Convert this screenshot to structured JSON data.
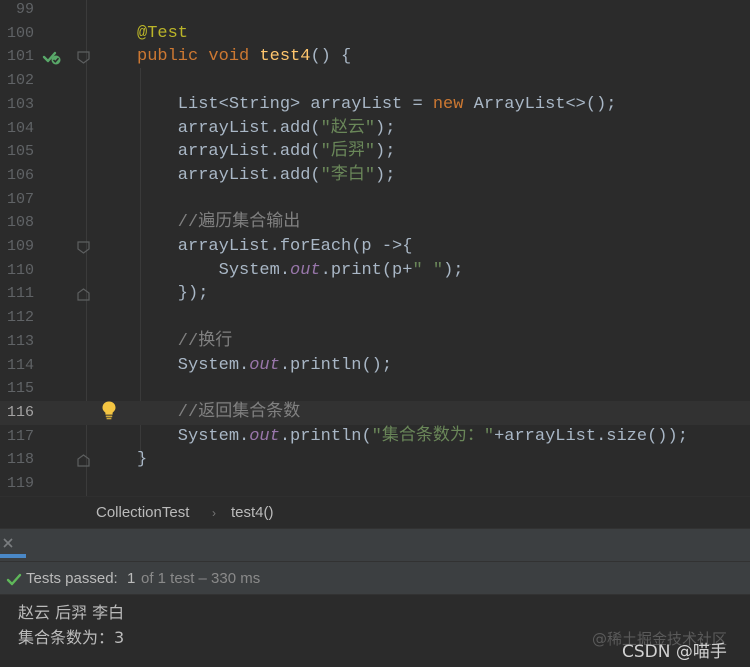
{
  "editor": {
    "current_line": 116,
    "lines": [
      {
        "no": "99",
        "tokens": []
      },
      {
        "no": "100",
        "tokens": [
          {
            "t": "@Test",
            "c": "ann"
          }
        ]
      },
      {
        "no": "101",
        "tokens": [
          {
            "t": "public",
            "c": "kw"
          },
          {
            "t": " ",
            "c": "default"
          },
          {
            "t": "void",
            "c": "kw"
          },
          {
            "t": " ",
            "c": "default"
          },
          {
            "t": "test4",
            "c": "fn"
          },
          {
            "t": "() {",
            "c": "default"
          }
        ]
      },
      {
        "no": "102",
        "tokens": []
      },
      {
        "no": "103",
        "tokens": [
          {
            "t": "    List<String> arrayList = ",
            "c": "default"
          },
          {
            "t": "new",
            "c": "kw"
          },
          {
            "t": " ArrayList<>();",
            "c": "default"
          }
        ]
      },
      {
        "no": "104",
        "tokens": [
          {
            "t": "    arrayList.add(",
            "c": "default"
          },
          {
            "t": "\"赵云\"",
            "c": "str"
          },
          {
            "t": ");",
            "c": "default"
          }
        ]
      },
      {
        "no": "105",
        "tokens": [
          {
            "t": "    arrayList.add(",
            "c": "default"
          },
          {
            "t": "\"后羿\"",
            "c": "str"
          },
          {
            "t": ");",
            "c": "default"
          }
        ]
      },
      {
        "no": "106",
        "tokens": [
          {
            "t": "    arrayList.add(",
            "c": "default"
          },
          {
            "t": "\"李白\"",
            "c": "str"
          },
          {
            "t": ");",
            "c": "default"
          }
        ]
      },
      {
        "no": "107",
        "tokens": []
      },
      {
        "no": "108",
        "tokens": [
          {
            "t": "    //遍历集合输出",
            "c": "cmt"
          }
        ]
      },
      {
        "no": "109",
        "tokens": [
          {
            "t": "    arrayList.forEach(p ->{",
            "c": "default"
          }
        ]
      },
      {
        "no": "110",
        "tokens": [
          {
            "t": "        System.",
            "c": "default"
          },
          {
            "t": "out",
            "c": "fld"
          },
          {
            "t": ".print(p+",
            "c": "default"
          },
          {
            "t": "\" \"",
            "c": "str"
          },
          {
            "t": ");",
            "c": "default"
          }
        ]
      },
      {
        "no": "111",
        "tokens": [
          {
            "t": "    });",
            "c": "default"
          }
        ]
      },
      {
        "no": "112",
        "tokens": []
      },
      {
        "no": "113",
        "tokens": [
          {
            "t": "    //换行",
            "c": "cmt"
          }
        ]
      },
      {
        "no": "114",
        "tokens": [
          {
            "t": "    System.",
            "c": "default"
          },
          {
            "t": "out",
            "c": "fld"
          },
          {
            "t": ".println();",
            "c": "default"
          }
        ]
      },
      {
        "no": "115",
        "tokens": []
      },
      {
        "no": "116",
        "tokens": [
          {
            "t": "    //返回集合条数",
            "c": "cmt"
          }
        ]
      },
      {
        "no": "117",
        "tokens": [
          {
            "t": "    System.",
            "c": "default"
          },
          {
            "t": "out",
            "c": "fld"
          },
          {
            "t": ".println(",
            "c": "default"
          },
          {
            "t": "\"集合条数为：\"",
            "c": "str"
          },
          {
            "t": "+arrayList.size());",
            "c": "default"
          }
        ]
      },
      {
        "no": "118",
        "tokens": [
          {
            "t": "}",
            "c": "default"
          }
        ]
      },
      {
        "no": "119",
        "tokens": []
      }
    ]
  },
  "breadcrumb": {
    "items": [
      "CollectionTest",
      "test4()"
    ],
    "separator": "›"
  },
  "test_status": {
    "label": "Tests passed: ",
    "passed": "1",
    "rest": " of 1 test – 330 ms"
  },
  "console": {
    "output_lines": [
      "赵云 后羿 李白",
      "集合条数为：3"
    ]
  },
  "watermark": "@稀土掘金技术社区",
  "footer_label": "CSDN @喵手",
  "icons": {
    "run": "run-test-icon",
    "bulb": "intention-bulb-icon",
    "fold": "fold-marker-icon",
    "close": "close-icon",
    "check": "check-icon"
  },
  "colors": {
    "background": "#2b2b2b",
    "keyword": "#cc7832",
    "string": "#6a8759",
    "method": "#ffc66d",
    "annotation": "#bbb529",
    "comment": "#808080",
    "field": "#9876aa",
    "passed": "#5fb85a"
  }
}
